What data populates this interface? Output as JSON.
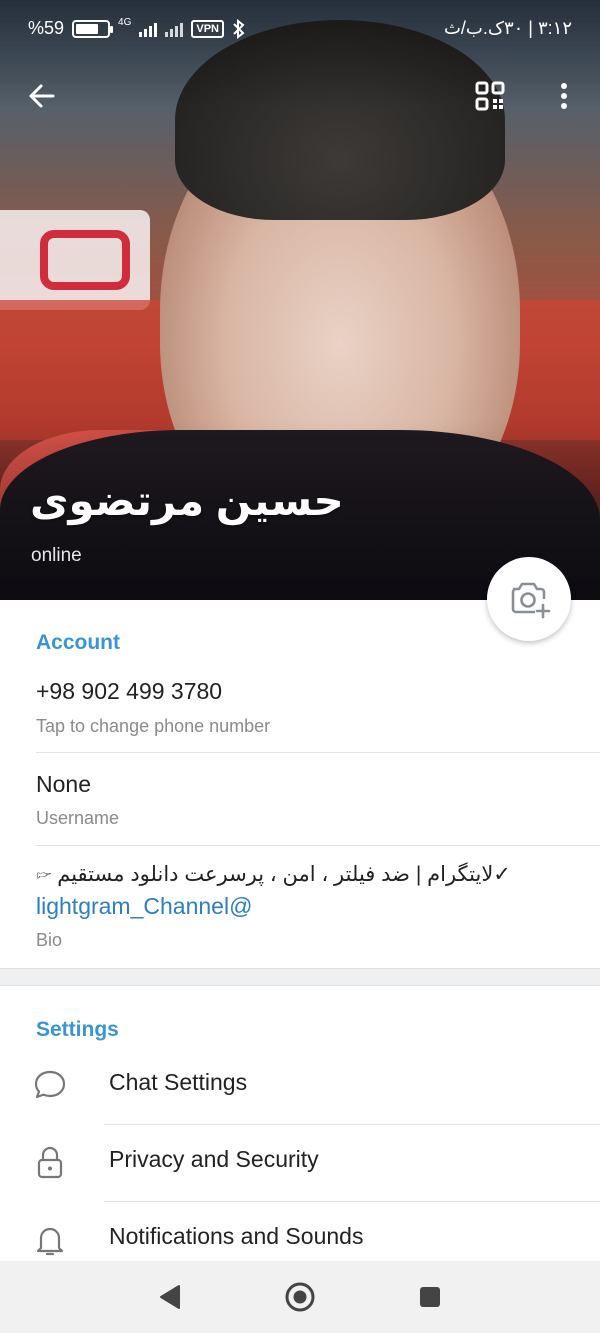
{
  "status_bar": {
    "battery": "%59",
    "network": "4G",
    "vpn": "VPN",
    "clock": "۳:۱۲ | ۳۰ک.ب/ث"
  },
  "profile": {
    "name": "حسین مرتضوی",
    "status": "online"
  },
  "account": {
    "title": "Account",
    "phone": "+98 902 499 3780",
    "phone_caption": "Tap to change phone number",
    "username": "None",
    "username_caption": "Username",
    "bio": "✓لایتگرام | ضد فیلتر ، امن ، پرسرعت دانلود مستقیم 🖙",
    "bio_link": "lightgram_Channel@",
    "bio_caption": "Bio"
  },
  "settings": {
    "title": "Settings",
    "items": [
      {
        "label": "Chat Settings",
        "icon": "chat-bubble-icon"
      },
      {
        "label": "Privacy and Security",
        "icon": "lock-icon"
      },
      {
        "label": "Notifications and Sounds",
        "icon": "bell-icon"
      }
    ]
  },
  "colors": {
    "accent": "#3a95d5",
    "link": "#2d7fc1",
    "caption": "#8b8b8b"
  }
}
